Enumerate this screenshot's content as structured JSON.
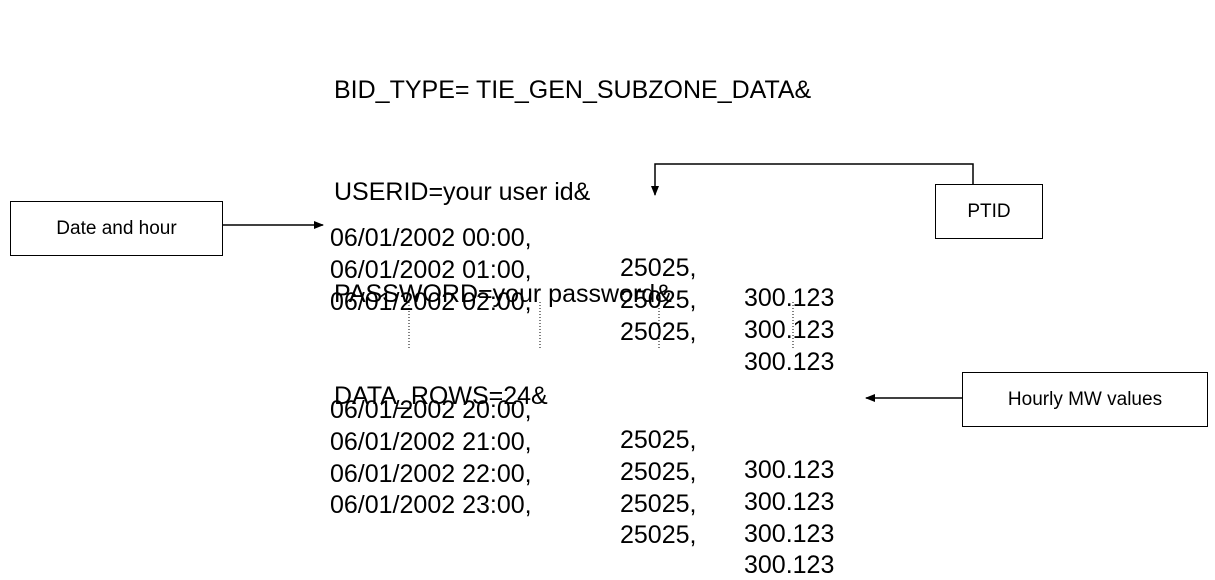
{
  "header_lines": [
    "BID_TYPE= TIE_GEN_SUBZONE_DATA&",
    "USERID=your user id&",
    "PASSWORD=your password&",
    "DATA_ROWS=24&"
  ],
  "rows_top": [
    {
      "datetime": "06/01/2002 00:00,",
      "ptid": "25025,",
      "mw": "300.123"
    },
    {
      "datetime": "06/01/2002 01:00,",
      "ptid": "25025,",
      "mw": "300.123"
    },
    {
      "datetime": "06/01/2002 02:00,",
      "ptid": "25025,",
      "mw": "300.123"
    }
  ],
  "rows_bottom": [
    {
      "datetime": "06/01/2002 20:00,",
      "ptid": "25025,",
      "mw": "300.123"
    },
    {
      "datetime": "06/01/2002 21:00,",
      "ptid": "25025,",
      "mw": "300.123"
    },
    {
      "datetime": "06/01/2002 22:00,",
      "ptid": "25025,",
      "mw": "300.123"
    },
    {
      "datetime": "06/01/2002 23:00,",
      "ptid": "25025,",
      "mw": "300.123"
    }
  ],
  "callouts": {
    "date_hour": "Date and hour",
    "ptid": "PTID",
    "hourly_mw": "Hourly MW values"
  }
}
